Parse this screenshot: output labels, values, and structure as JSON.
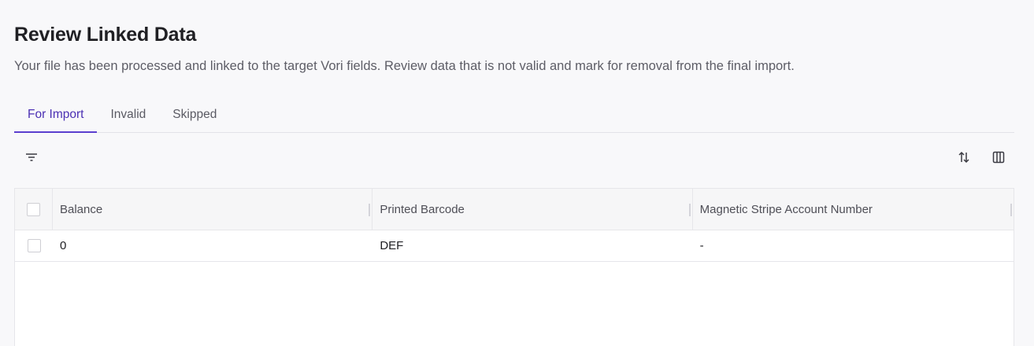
{
  "header": {
    "title": "Review Linked Data",
    "subtitle": "Your file has been processed and linked to the target Vori fields. Review data that is not valid and mark for removal from the final import."
  },
  "tabs": [
    {
      "label": "For Import",
      "active": true
    },
    {
      "label": "Invalid",
      "active": false
    },
    {
      "label": "Skipped",
      "active": false
    }
  ],
  "toolbar": {
    "filter_icon": "filter-icon",
    "sort_icon": "sort-icon",
    "columns_icon": "columns-icon"
  },
  "table": {
    "columns": [
      "Balance",
      "Printed Barcode",
      "Magnetic Stripe Account Number"
    ],
    "rows": [
      [
        "0",
        "DEF",
        "-"
      ]
    ]
  },
  "colors": {
    "accent": "#5b3fcf",
    "background": "#f8f8fa"
  }
}
